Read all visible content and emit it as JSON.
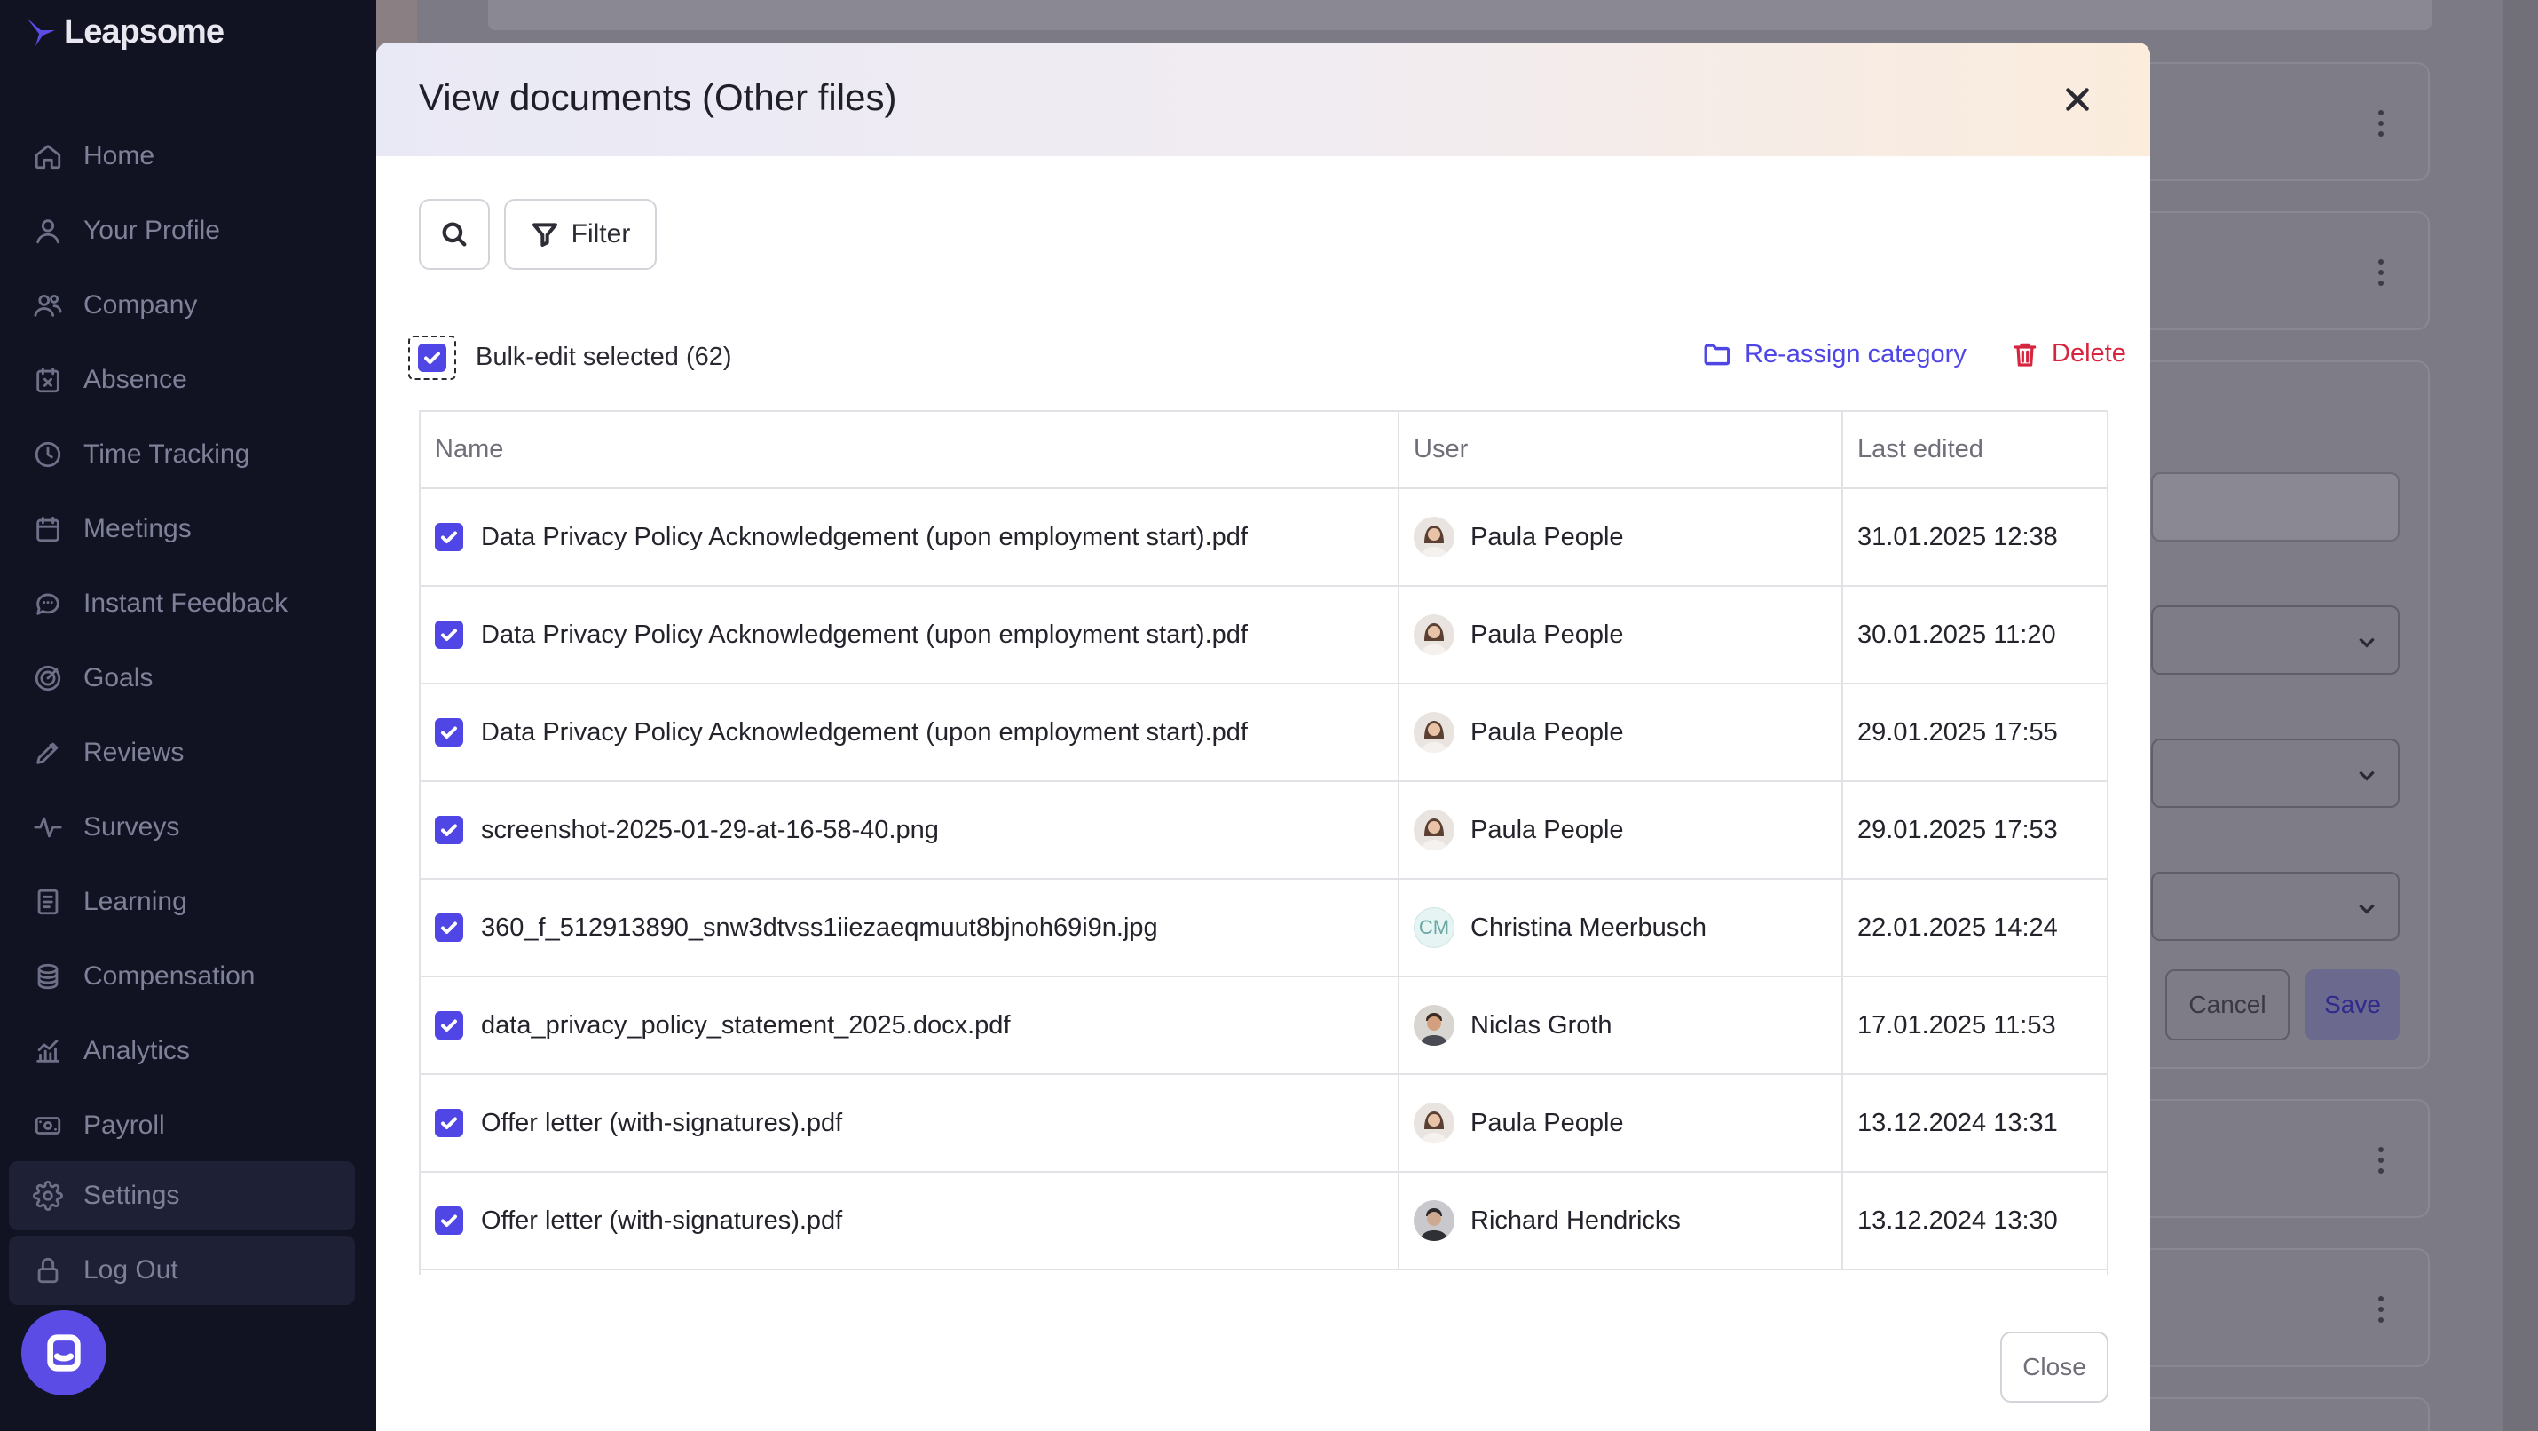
{
  "app": {
    "brand": "Leapsome"
  },
  "sidebar": {
    "items": [
      {
        "label": "Home",
        "icon": "home-icon"
      },
      {
        "label": "Your Profile",
        "icon": "user-icon"
      },
      {
        "label": "Company",
        "icon": "users-icon"
      },
      {
        "label": "Absence",
        "icon": "calendar-x-icon"
      },
      {
        "label": "Time Tracking",
        "icon": "clock-icon"
      },
      {
        "label": "Meetings",
        "icon": "calendar-icon"
      },
      {
        "label": "Instant Feedback",
        "icon": "chat-bubble-icon"
      },
      {
        "label": "Goals",
        "icon": "target-icon"
      },
      {
        "label": "Reviews",
        "icon": "pen-icon"
      },
      {
        "label": "Surveys",
        "icon": "pulse-icon"
      },
      {
        "label": "Learning",
        "icon": "book-icon"
      },
      {
        "label": "Compensation",
        "icon": "coins-icon"
      },
      {
        "label": "Analytics",
        "icon": "bar-chart-icon"
      },
      {
        "label": "Payroll",
        "icon": "banknote-icon"
      }
    ],
    "settings": {
      "label": "Settings",
      "icon": "gear-icon"
    },
    "logout": {
      "label": "Log Out",
      "icon": "lock-icon"
    }
  },
  "background": {
    "cancel_label": "Cancel",
    "save_label": "Save"
  },
  "modal": {
    "title": "View documents (Other files)",
    "filter_label": "Filter",
    "bulk_label": "Bulk-edit selected (62)",
    "reassign_label": "Re-assign category",
    "delete_label": "Delete",
    "close_label": "Close",
    "columns": {
      "name": "Name",
      "user": "User",
      "edited": "Last edited"
    },
    "rows": [
      {
        "name": "Data Privacy Policy Acknowledgement (upon employment start).pdf",
        "user": "Paula People",
        "avatar": "photo-woman",
        "edited": "31.01.2025 12:38"
      },
      {
        "name": "Data Privacy Policy Acknowledgement (upon employment start).pdf",
        "user": "Paula People",
        "avatar": "photo-woman",
        "edited": "30.01.2025 11:20"
      },
      {
        "name": "Data Privacy Policy Acknowledgement (upon employment start).pdf",
        "user": "Paula People",
        "avatar": "photo-woman",
        "edited": "29.01.2025 17:55"
      },
      {
        "name": "screenshot-2025-01-29-at-16-58-40.png",
        "user": "Paula People",
        "avatar": "photo-woman",
        "edited": "29.01.2025 17:53"
      },
      {
        "name": "360_f_512913890_snw3dtvss1iiezaeqmuut8bjnoh69i9n.jpg",
        "user": "Christina Meerbusch",
        "avatar": "initials",
        "initials": "CM",
        "edited": "22.01.2025 14:24"
      },
      {
        "name": "data_privacy_policy_statement_2025.docx.pdf",
        "user": "Niclas Groth",
        "avatar": "photo-man",
        "edited": "17.01.2025 11:53"
      },
      {
        "name": "Offer letter (with-signatures).pdf",
        "user": "Paula People",
        "avatar": "photo-woman",
        "edited": "13.12.2024 13:31"
      },
      {
        "name": "Offer letter (with-signatures).pdf",
        "user": "Richard Hendricks",
        "avatar": "photo-man-dark",
        "edited": "13.12.2024 13:30"
      }
    ]
  },
  "colors": {
    "accent": "#5046e5",
    "danger": "#d6263f",
    "sidebar_bg": "#111322"
  }
}
